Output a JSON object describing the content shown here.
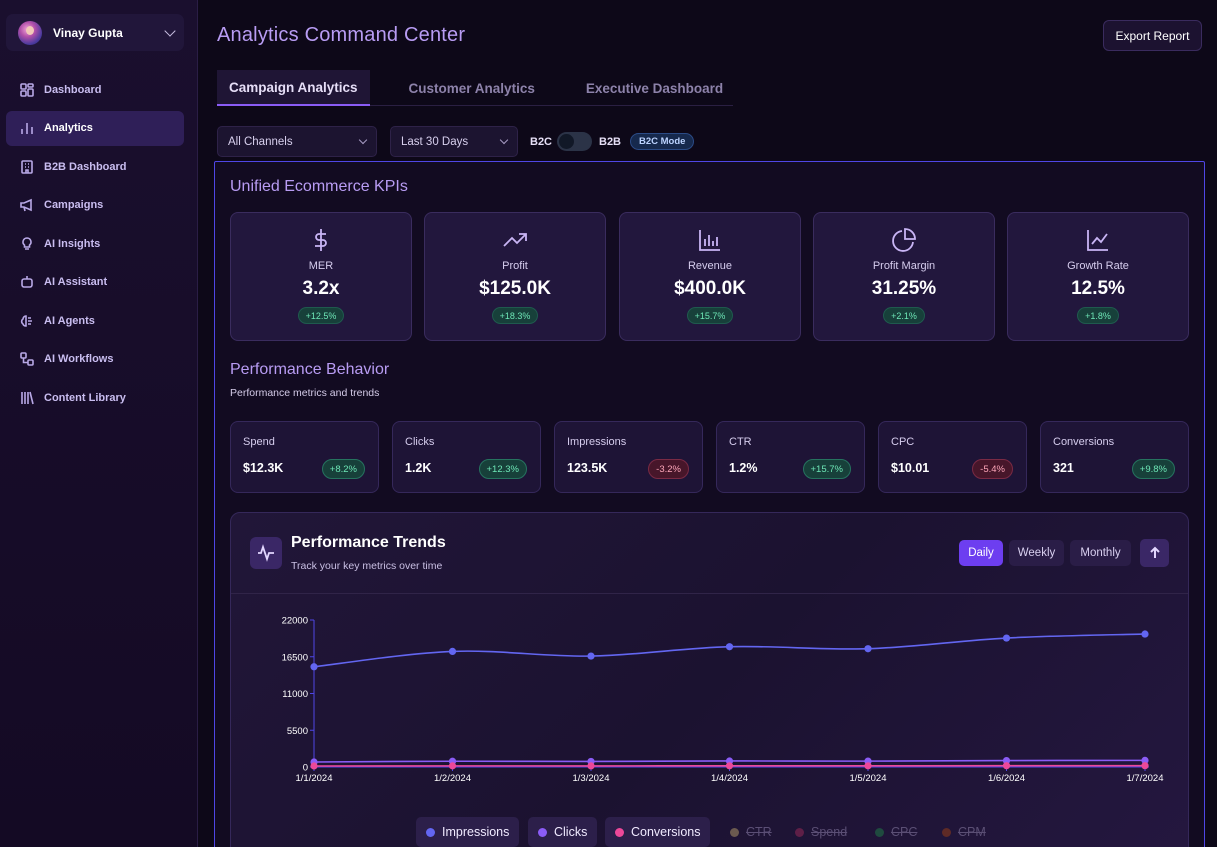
{
  "user": {
    "name": "Vinay Gupta"
  },
  "sidebar": {
    "items": [
      {
        "label": "Dashboard",
        "icon": "grid-icon"
      },
      {
        "label": "Analytics",
        "icon": "bar-chart-icon",
        "active": true
      },
      {
        "label": "B2B Dashboard",
        "icon": "building-icon"
      },
      {
        "label": "Campaigns",
        "icon": "megaphone-icon"
      },
      {
        "label": "AI Insights",
        "icon": "lightbulb-icon"
      },
      {
        "label": "AI Assistant",
        "icon": "bot-icon"
      },
      {
        "label": "AI Agents",
        "icon": "brain-icon"
      },
      {
        "label": "AI Workflows",
        "icon": "workflow-icon"
      },
      {
        "label": "Content Library",
        "icon": "library-icon"
      }
    ]
  },
  "header": {
    "title": "Analytics Command Center",
    "export_label": "Export Report"
  },
  "tabs": [
    {
      "label": "Campaign Analytics",
      "active": true
    },
    {
      "label": "Customer Analytics"
    },
    {
      "label": "Executive Dashboard"
    }
  ],
  "filters": {
    "channel": "All Channels",
    "range": "Last 30 Days",
    "b2c_label": "B2C",
    "b2b_label": "B2B",
    "mode_badge": "B2C Mode"
  },
  "kpi_section": {
    "title": "Unified Ecommerce KPIs",
    "cards": [
      {
        "label": "MER",
        "value": "3.2x",
        "delta": "+12.5%",
        "icon": "dollar-icon"
      },
      {
        "label": "Profit",
        "value": "$125.0K",
        "delta": "+18.3%",
        "icon": "trending-up-icon"
      },
      {
        "label": "Revenue",
        "value": "$400.0K",
        "delta": "+15.7%",
        "icon": "bar-chart-icon"
      },
      {
        "label": "Profit Margin",
        "value": "31.25%",
        "delta": "+2.1%",
        "icon": "pie-chart-icon"
      },
      {
        "label": "Growth Rate",
        "value": "12.5%",
        "delta": "+1.8%",
        "icon": "line-chart-icon"
      }
    ]
  },
  "performance": {
    "title": "Performance Behavior",
    "subtitle": "Performance metrics and trends",
    "metrics": [
      {
        "label": "Spend",
        "value": "$12.3K",
        "delta": "+8.2%",
        "positive": true
      },
      {
        "label": "Clicks",
        "value": "1.2K",
        "delta": "+12.3%",
        "positive": true
      },
      {
        "label": "Impressions",
        "value": "123.5K",
        "delta": "-3.2%",
        "positive": false
      },
      {
        "label": "CTR",
        "value": "1.2%",
        "delta": "+15.7%",
        "positive": true
      },
      {
        "label": "CPC",
        "value": "$10.01",
        "delta": "-5.4%",
        "positive": false
      },
      {
        "label": "Conversions",
        "value": "321",
        "delta": "+9.8%",
        "positive": true
      }
    ]
  },
  "trends": {
    "title": "Performance Trends",
    "subtitle": "Track your key metrics over time",
    "periods": [
      "Daily",
      "Weekly",
      "Monthly"
    ],
    "active_period": "Daily"
  },
  "chart_data": {
    "type": "line",
    "x": [
      "1/1/2024",
      "1/2/2024",
      "1/3/2024",
      "1/4/2024",
      "1/5/2024",
      "1/6/2024",
      "1/7/2024"
    ],
    "yticks": [
      0,
      5500,
      11000,
      16500,
      22000
    ],
    "ylim": [
      0,
      22000
    ],
    "series": [
      {
        "name": "Impressions",
        "color": "#6366f1",
        "values": [
          15000,
          17300,
          16600,
          18000,
          17700,
          19300,
          19900
        ],
        "visible": true
      },
      {
        "name": "Clicks",
        "color": "#8b5cf6",
        "values": [
          750,
          860,
          830,
          900,
          880,
          960,
          990
        ],
        "visible": true
      },
      {
        "name": "Conversions",
        "color": "#ec4899",
        "values": [
          150,
          170,
          165,
          180,
          175,
          190,
          200
        ],
        "visible": true
      },
      {
        "name": "CTR",
        "color": "#c4987a",
        "visible": false
      },
      {
        "name": "Spend",
        "color": "#b3246a",
        "visible": false
      },
      {
        "name": "CPC",
        "color": "#2f8a6a",
        "visible": false
      },
      {
        "name": "CPM",
        "color": "#c2513a",
        "visible": false
      }
    ],
    "grid": false,
    "legend": "bottom"
  }
}
